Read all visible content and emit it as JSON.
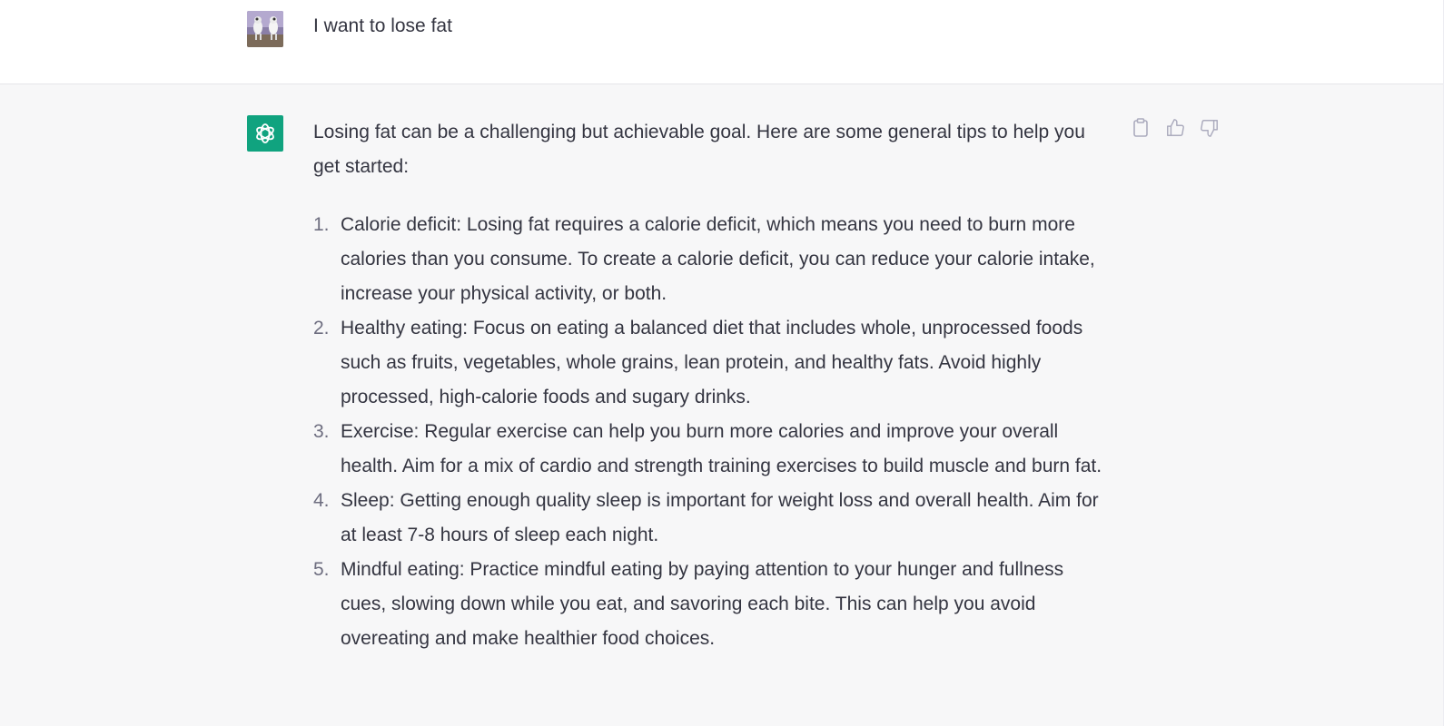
{
  "user_message": {
    "text": "I want to lose fat"
  },
  "assistant_message": {
    "intro": "Losing fat can be a challenging but achievable goal. Here are some general tips to help you get started:",
    "tips": [
      {
        "number": "1.",
        "text": "Calorie deficit: Losing fat requires a calorie deficit, which means you need to burn more calories than you consume. To create a calorie deficit, you can reduce your calorie intake, increase your physical activity, or both."
      },
      {
        "number": "2.",
        "text": "Healthy eating: Focus on eating a balanced diet that includes whole, unprocessed foods such as fruits, vegetables, whole grains, lean protein, and healthy fats. Avoid highly processed, high-calorie foods and sugary drinks."
      },
      {
        "number": "3.",
        "text": "Exercise: Regular exercise can help you burn more calories and improve your overall health. Aim for a mix of cardio and strength training exercises to build muscle and burn fat."
      },
      {
        "number": "4.",
        "text": "Sleep: Getting enough quality sleep is important for weight loss and overall health. Aim for at least 7-8 hours of sleep each night."
      },
      {
        "number": "5.",
        "text": "Mindful eating: Practice mindful eating by paying attention to your hunger and fullness cues, slowing down while you eat, and savoring each bite. This can help you avoid overeating and make healthier food choices."
      }
    ]
  },
  "actions": {
    "copy_icon": "clipboard-icon",
    "like_icon": "thumbs-up-icon",
    "dislike_icon": "thumbs-down-icon"
  },
  "colors": {
    "assistant_bg": "#f7f7f8",
    "brand_green": "#10a37f",
    "text": "#343541",
    "icon_gray": "#acacbe"
  }
}
